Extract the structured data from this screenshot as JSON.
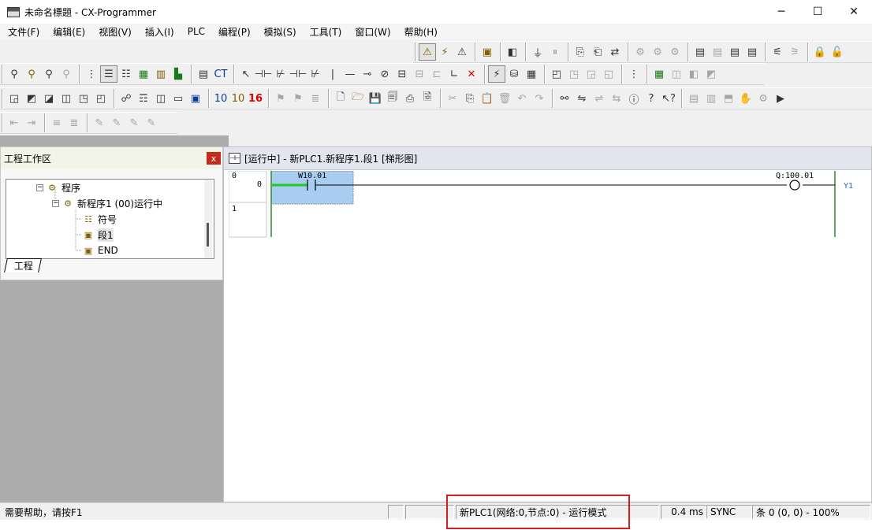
{
  "window": {
    "title": "未命名標題 - CX-Programmer",
    "minimize": "─",
    "maximize": "☐",
    "close": "✕"
  },
  "menu": [
    "文件(F)",
    "编辑(E)",
    "视图(V)",
    "插入(I)",
    "PLC",
    "编程(P)",
    "模拟(S)",
    "工具(T)",
    "窗口(W)",
    "帮助(H)"
  ],
  "project_panel": {
    "title": "工程工作区",
    "close": "x",
    "tree": [
      {
        "label": "程序",
        "box": "−",
        "icon": "program-icon"
      },
      {
        "label": "新程序1 (00)运行中",
        "box": "−",
        "icon": "task-icon"
      },
      {
        "label": "符号",
        "icon": "symbols-icon"
      },
      {
        "label": "段1",
        "icon": "section-icon"
      },
      {
        "label": "END",
        "icon": "end-section-icon"
      }
    ],
    "tab": "工程"
  },
  "ladder": {
    "title": "[运行中] - 新PLC1.新程序1.段1 [梯形图]",
    "rungs": [
      {
        "number": "0",
        "step": "0"
      },
      {
        "number": "1",
        "step": ""
      }
    ],
    "contact_address": "W10.01",
    "coil_address": "Q:100.01",
    "coil_comment": "Y1"
  },
  "status_bar": {
    "help": "需要帮助，请按F1",
    "plc": "新PLC1(网络:0,节点:0) - 运行模式",
    "scan_time": "0.4 ms",
    "sync": "SYNC",
    "position": "条 0 (0, 0)  - 100%"
  },
  "colors": {
    "selection": "#a8cdf0",
    "power_flow": "#1dcc1d",
    "rail": "#2e8b2e",
    "highlight": "#d41f1f"
  }
}
